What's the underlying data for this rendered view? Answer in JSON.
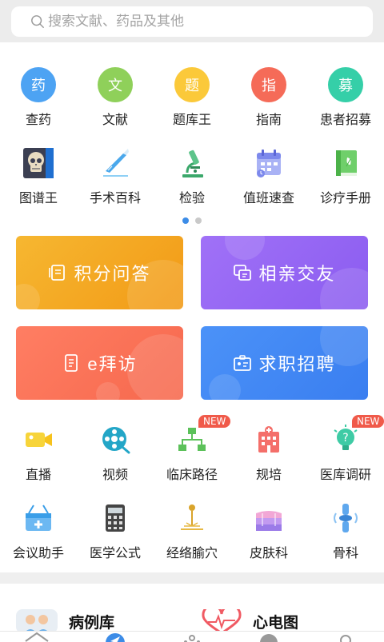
{
  "search": {
    "placeholder": "搜索文献、药品及其他"
  },
  "row1": [
    {
      "glyph": "药",
      "label": "查药",
      "color": "#4da3f3"
    },
    {
      "glyph": "文",
      "label": "文献",
      "color": "#8fd05a"
    },
    {
      "glyph": "题",
      "label": "题库王",
      "color": "#fbc93a"
    },
    {
      "glyph": "指",
      "label": "指南",
      "color": "#f56b58"
    },
    {
      "glyph": "募",
      "label": "患者招募",
      "color": "#35cfa8"
    }
  ],
  "row2": [
    {
      "label": "图谱王"
    },
    {
      "label": "手术百科"
    },
    {
      "label": "检验"
    },
    {
      "label": "值班速查"
    },
    {
      "label": "诊疗手册"
    }
  ],
  "cards": {
    "qa": "积分问答",
    "dating": "相亲交友",
    "visit": "e拜访",
    "jobs": "求职招聘"
  },
  "row3": [
    {
      "label": "直播"
    },
    {
      "label": "视频"
    },
    {
      "label": "临床路径",
      "badge": "NEW"
    },
    {
      "label": "规培"
    },
    {
      "label": "医库调研",
      "badge": "NEW"
    }
  ],
  "row4": [
    {
      "label": "会议助手"
    },
    {
      "label": "医学公式"
    },
    {
      "label": "经络腧穴"
    },
    {
      "label": "皮肤科"
    },
    {
      "label": "骨科"
    }
  ],
  "bottom": {
    "left": "病例库",
    "right": "心电图"
  }
}
